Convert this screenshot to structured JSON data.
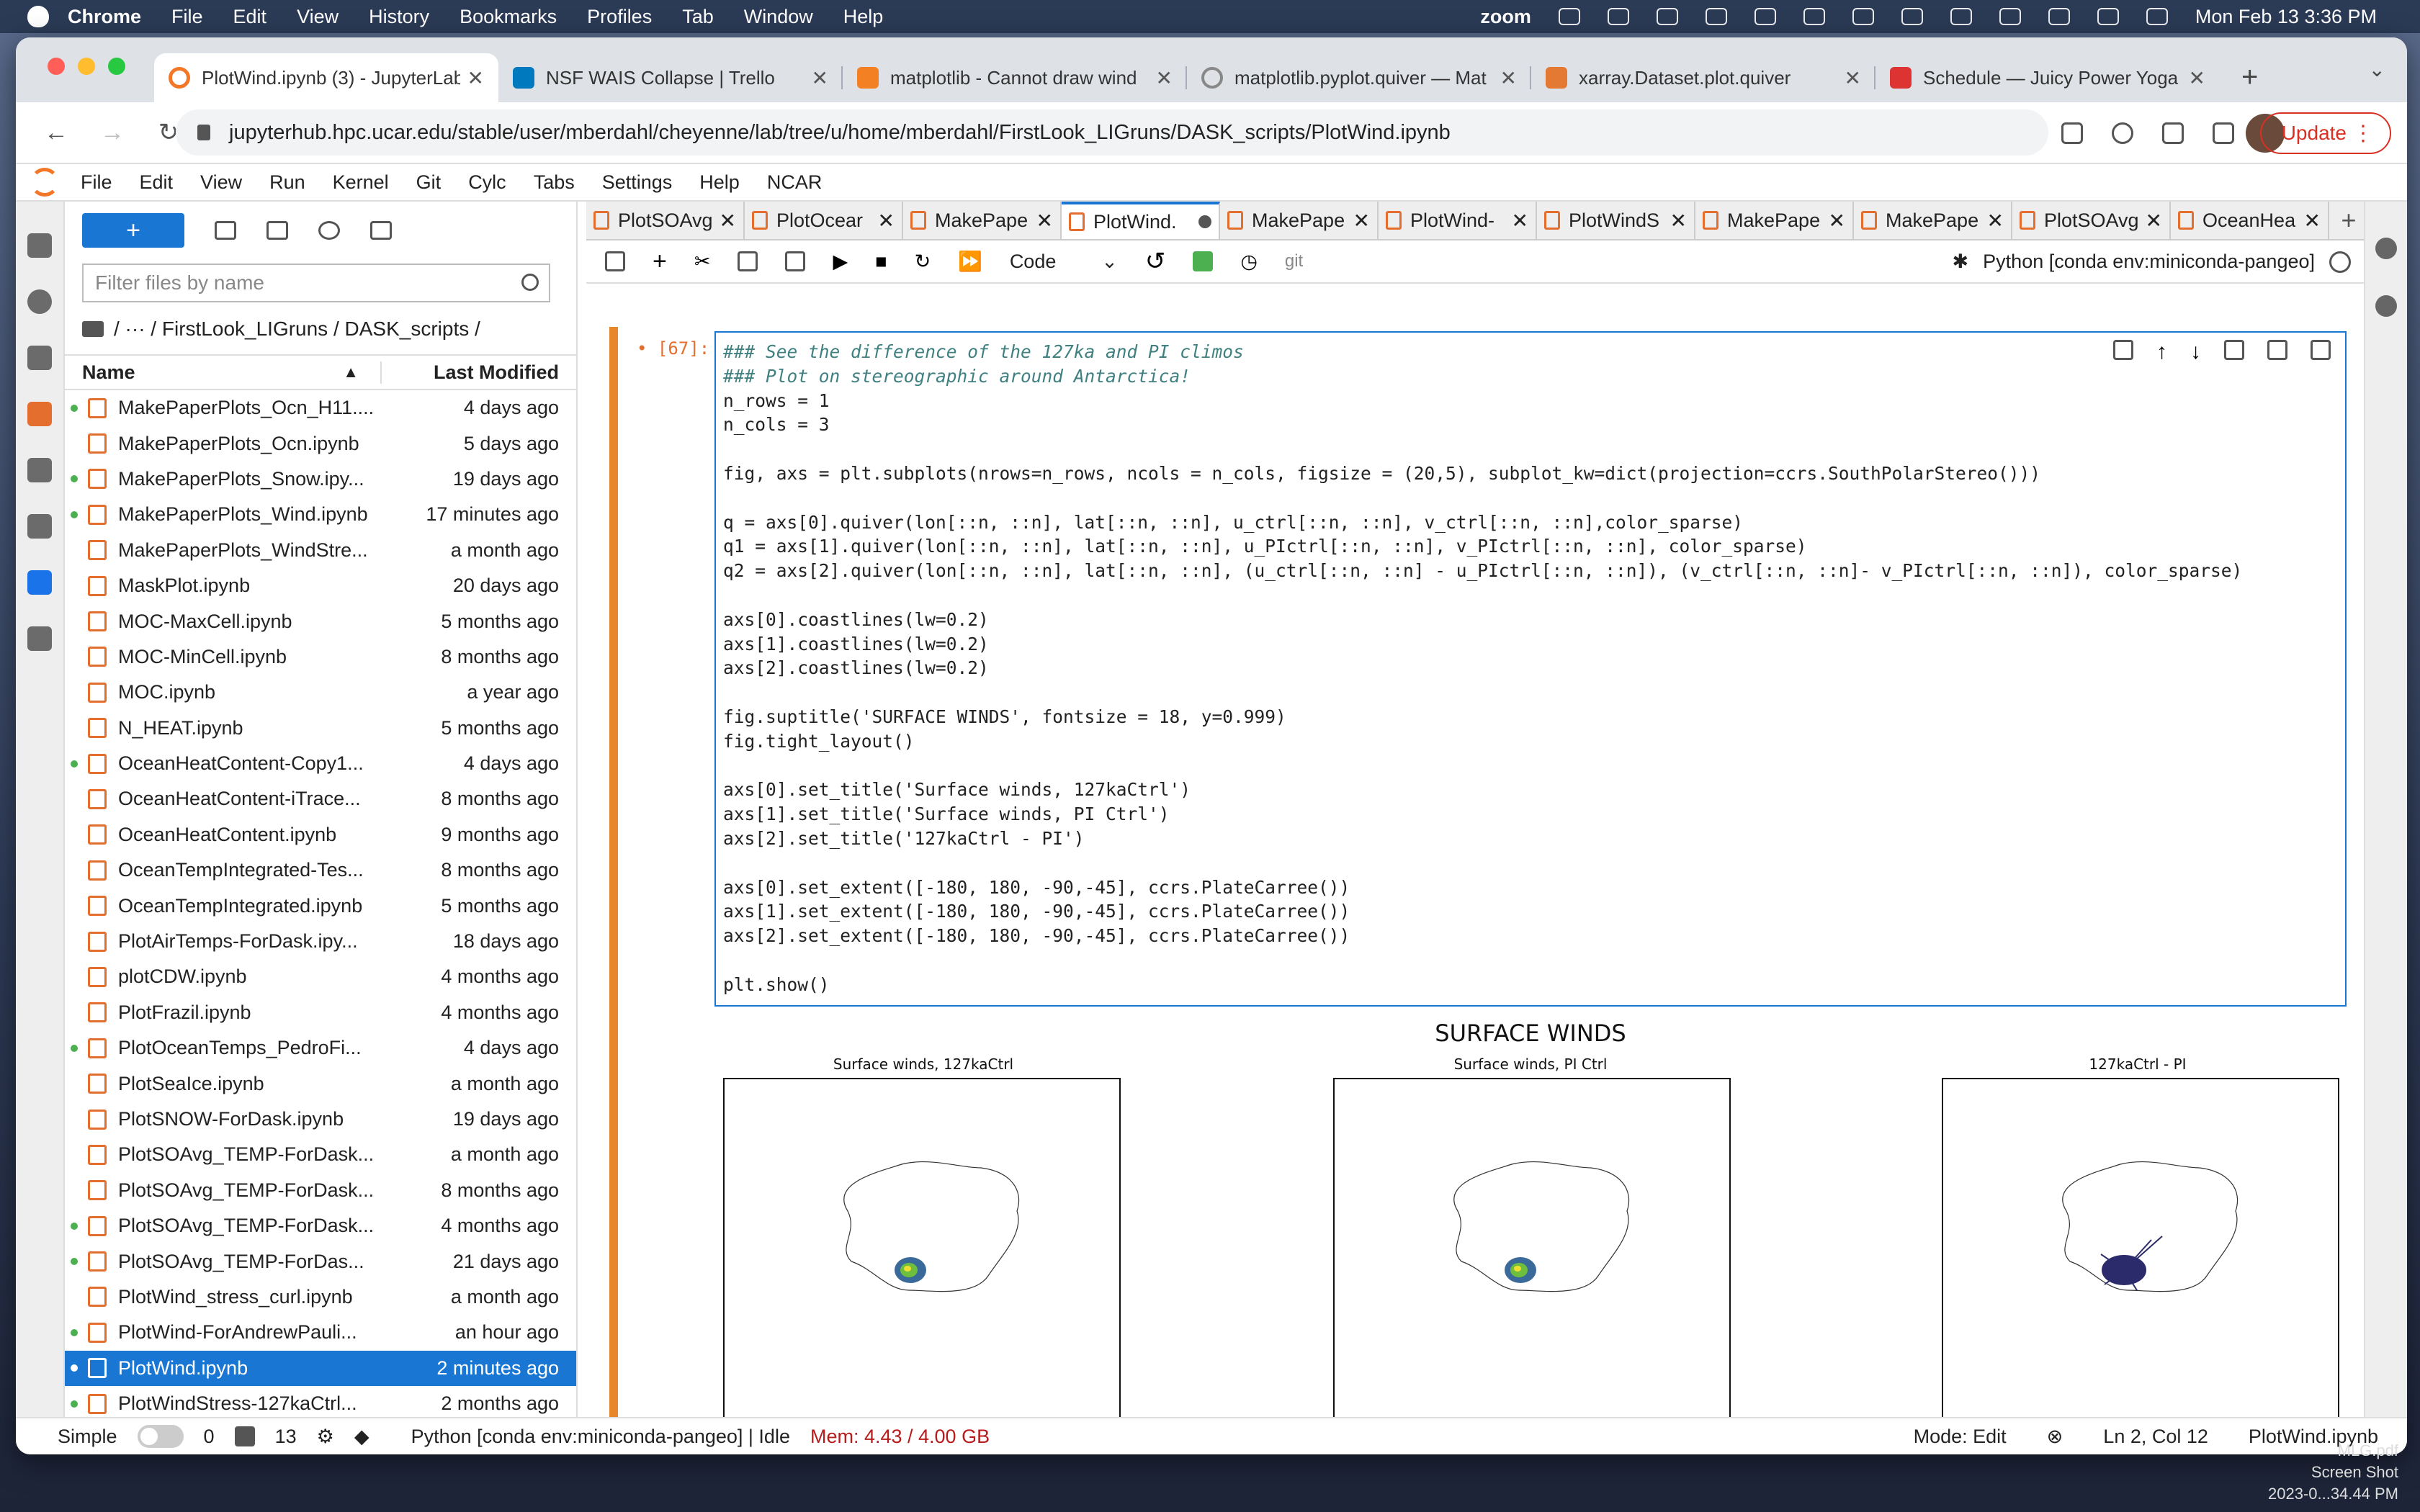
{
  "menubar": {
    "app": "Chrome",
    "items": [
      "File",
      "Edit",
      "View",
      "History",
      "Bookmarks",
      "Profiles",
      "Tab",
      "Window",
      "Help"
    ],
    "zoom_label": "zoom",
    "datetime": "Mon Feb 13  3:36 PM"
  },
  "chrome": {
    "tabs": [
      {
        "label": "PlotWind.ipynb (3) - JupyterLab",
        "color": "#f37726",
        "active": true
      },
      {
        "label": "NSF WAIS Collapse | Trello",
        "color": "#0079bf"
      },
      {
        "label": "matplotlib - Cannot draw wind",
        "color": "#f48024"
      },
      {
        "label": "matplotlib.pyplot.quiver — Mat",
        "color": "#888888"
      },
      {
        "label": "xarray.Dataset.plot.quiver",
        "color": "#e37933"
      },
      {
        "label": "Schedule — Juicy Power Yoga",
        "color": "#d33"
      }
    ],
    "url": "jupyterhub.hpc.ucar.edu/stable/user/mberdahl/cheyenne/lab/tree/u/home/mberdahl/FirstLook_LIGruns/DASK_scripts/PlotWind.ipynb",
    "update_label": "Update"
  },
  "jupyter_menu": [
    "File",
    "Edit",
    "View",
    "Run",
    "Kernel",
    "Git",
    "Cylc",
    "Tabs",
    "Settings",
    "Help",
    "NCAR"
  ],
  "filebrowser": {
    "filter_placeholder": "Filter files by name",
    "breadcrumb": "/   ···   / FirstLook_LIGruns / DASK_scripts /",
    "col_name": "Name",
    "col_modified": "Last Modified",
    "files": [
      {
        "name": "MakePaperPlots_Ocn_H11....",
        "modified": "4 days ago",
        "running": true
      },
      {
        "name": "MakePaperPlots_Ocn.ipynb",
        "modified": "5 days ago",
        "running": false
      },
      {
        "name": "MakePaperPlots_Snow.ipy...",
        "modified": "19 days ago",
        "running": true
      },
      {
        "name": "MakePaperPlots_Wind.ipynb",
        "modified": "17 minutes ago",
        "running": true
      },
      {
        "name": "MakePaperPlots_WindStre...",
        "modified": "a month ago",
        "running": false
      },
      {
        "name": "MaskPlot.ipynb",
        "modified": "20 days ago",
        "running": false
      },
      {
        "name": "MOC-MaxCell.ipynb",
        "modified": "5 months ago",
        "running": false
      },
      {
        "name": "MOC-MinCell.ipynb",
        "modified": "8 months ago",
        "running": false
      },
      {
        "name": "MOC.ipynb",
        "modified": "a year ago",
        "running": false
      },
      {
        "name": "N_HEAT.ipynb",
        "modified": "5 months ago",
        "running": false
      },
      {
        "name": "OceanHeatContent-Copy1...",
        "modified": "4 days ago",
        "running": true
      },
      {
        "name": "OceanHeatContent-iTrace...",
        "modified": "8 months ago",
        "running": false
      },
      {
        "name": "OceanHeatContent.ipynb",
        "modified": "9 months ago",
        "running": false
      },
      {
        "name": "OceanTempIntegrated-Tes...",
        "modified": "8 months ago",
        "running": false
      },
      {
        "name": "OceanTempIntegrated.ipynb",
        "modified": "5 months ago",
        "running": false
      },
      {
        "name": "PlotAirTemps-ForDask.ipy...",
        "modified": "18 days ago",
        "running": false
      },
      {
        "name": "plotCDW.ipynb",
        "modified": "4 months ago",
        "running": false
      },
      {
        "name": "PlotFrazil.ipynb",
        "modified": "4 months ago",
        "running": false
      },
      {
        "name": "PlotOceanTemps_PedroFi...",
        "modified": "4 days ago",
        "running": true
      },
      {
        "name": "PlotSeaIce.ipynb",
        "modified": "a month ago",
        "running": false
      },
      {
        "name": "PlotSNOW-ForDask.ipynb",
        "modified": "19 days ago",
        "running": false
      },
      {
        "name": "PlotSOAvg_TEMP-ForDask...",
        "modified": "a month ago",
        "running": false
      },
      {
        "name": "PlotSOAvg_TEMP-ForDask...",
        "modified": "8 months ago",
        "running": false
      },
      {
        "name": "PlotSOAvg_TEMP-ForDask...",
        "modified": "4 months ago",
        "running": true
      },
      {
        "name": "PlotSOAvg_TEMP-ForDas...",
        "modified": "21 days ago",
        "running": true
      },
      {
        "name": "PlotWind_stress_curl.ipynb",
        "modified": "a month ago",
        "running": false
      },
      {
        "name": "PlotWind-ForAndrewPauli...",
        "modified": "an hour ago",
        "running": true
      },
      {
        "name": "PlotWind.ipynb",
        "modified": "2 minutes ago",
        "running": true,
        "selected": true
      },
      {
        "name": "PlotWindStress-127kaCtrl...",
        "modified": "2 months ago",
        "running": true
      }
    ]
  },
  "doc_tabs": [
    {
      "label": "PlotSOAvg"
    },
    {
      "label": "PlotOcear"
    },
    {
      "label": "MakePape"
    },
    {
      "label": "PlotWind.",
      "active": true
    },
    {
      "label": "MakePape"
    },
    {
      "label": "PlotWind-"
    },
    {
      "label": "PlotWindS"
    },
    {
      "label": "MakePape"
    },
    {
      "label": "MakePape"
    },
    {
      "label": "PlotSOAvg"
    },
    {
      "label": "OceanHea"
    }
  ],
  "notebook_toolbar": {
    "cell_type": "Code",
    "git": "git",
    "kernel": "Python [conda env:miniconda-pangeo]"
  },
  "cell": {
    "prompt": "[67]:",
    "lines": [
      "### See the difference of the 127ka and PI climos",
      "### Plot on stereographic around Antarctica!",
      "n_rows = 1",
      "n_cols = 3",
      "",
      "fig, axs = plt.subplots(nrows=n_rows, ncols = n_cols, figsize = (20,5), subplot_kw=dict(projection=ccrs.SouthPolarStereo()))",
      "",
      "q = axs[0].quiver(lon[::n, ::n], lat[::n, ::n], u_ctrl[::n, ::n], v_ctrl[::n, ::n],color_sparse)",
      "q1 = axs[1].quiver(lon[::n, ::n], lat[::n, ::n], u_PIctrl[::n, ::n], v_PIctrl[::n, ::n], color_sparse)",
      "q2 = axs[2].quiver(lon[::n, ::n], lat[::n, ::n], (u_ctrl[::n, ::n] - u_PIctrl[::n, ::n]), (v_ctrl[::n, ::n]- v_PIctrl[::n, ::n]), color_sparse)",
      "",
      "axs[0].coastlines(lw=0.2)",
      "axs[1].coastlines(lw=0.2)",
      "axs[2].coastlines(lw=0.2)",
      "",
      "fig.suptitle('SURFACE WINDS', fontsize = 18, y=0.999)",
      "fig.tight_layout()",
      "",
      "axs[0].set_title('Surface winds, 127kaCtrl')",
      "axs[1].set_title('Surface winds, PI Ctrl')",
      "axs[2].set_title('127kaCtrl - PI')",
      "",
      "axs[0].set_extent([-180, 180, -90,-45], ccrs.PlateCarree())",
      "axs[1].set_extent([-180, 180, -90,-45], ccrs.PlateCarree())",
      "axs[2].set_extent([-180, 180, -90,-45], ccrs.PlateCarree())",
      "",
      "plt.show()"
    ]
  },
  "figure": {
    "suptitle": "SURFACE WINDS",
    "panels": [
      {
        "title": "Surface winds, 127kaCtrl"
      },
      {
        "title": "Surface winds, PI Ctrl"
      },
      {
        "title": "127kaCtrl - PI"
      }
    ]
  },
  "statusbar": {
    "simple": "Simple",
    "count_a": "0",
    "count_b": "13",
    "kernel_status": "Python [conda env:miniconda-pangeo] | Idle",
    "memory": "Mem: 4.43 / 4.00 GB",
    "mode": "Mode: Edit",
    "cursor": "Ln 2, Col 12",
    "filename": "PlotWind.ipynb"
  },
  "desktop_files": [
    "MLG.pdf",
    "Screen Shot",
    "2023-0...34.44 PM"
  ]
}
